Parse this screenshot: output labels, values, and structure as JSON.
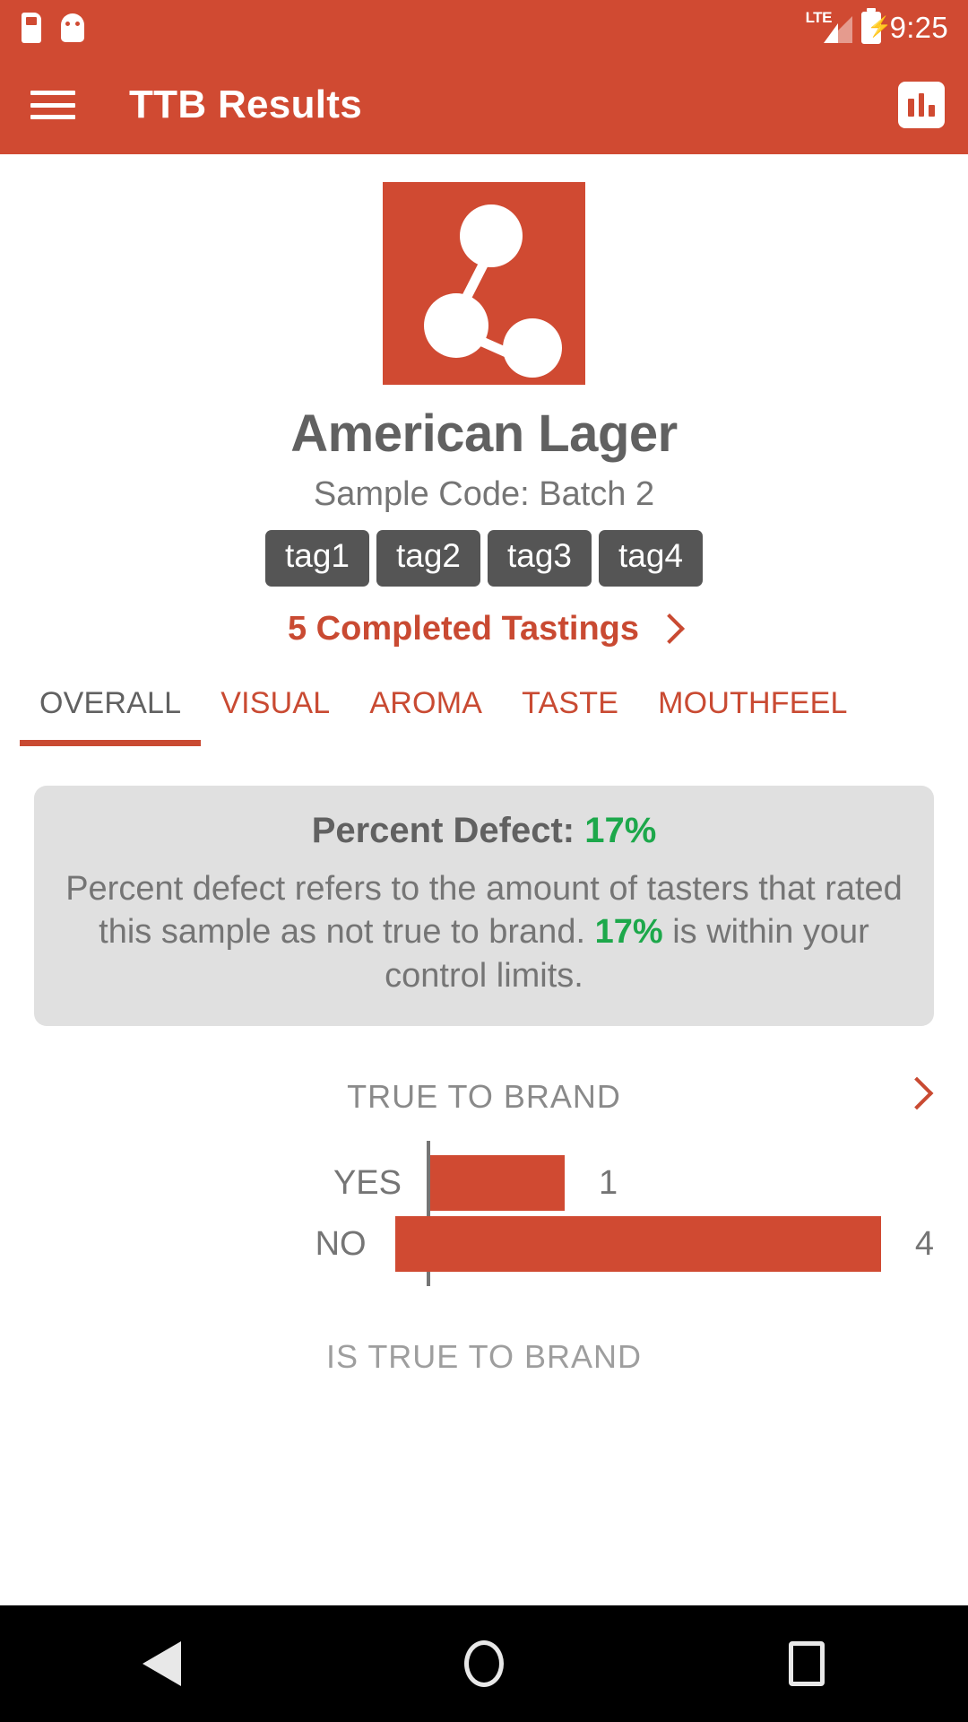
{
  "status_bar": {
    "time": "9:25",
    "network_label": "LTE",
    "icons": [
      "sd-card-icon",
      "android-robot-icon",
      "lte-signal-icon",
      "battery-charging-icon"
    ]
  },
  "app_bar": {
    "title": "TTB Results",
    "menu_icon": "hamburger-menu-icon",
    "action_icon": "bar-chart-icon"
  },
  "sample": {
    "logo_icon": "molecule-network-logo",
    "name": "American Lager",
    "sample_code": "Sample Code: Batch 2",
    "tags": [
      "tag1",
      "tag2",
      "tag3",
      "tag4"
    ],
    "tastings_link": "5 Completed Tastings",
    "tastings_chevron": "chevron-right-icon"
  },
  "tabs": [
    {
      "label": "OVERALL",
      "active": true
    },
    {
      "label": "VISUAL",
      "active": false
    },
    {
      "label": "AROMA",
      "active": false
    },
    {
      "label": "TASTE",
      "active": false
    },
    {
      "label": "MOUTHFEEL",
      "active": false
    }
  ],
  "defect_card": {
    "heading_label": "Percent Defect: ",
    "heading_value": "17%",
    "body_part1": "Percent defect refers to the amount of tasters that rated this sample as not true to brand. ",
    "body_value": "17%",
    "body_part2": " is within your control limits."
  },
  "chart_section": {
    "arrow_icon": "chevron-right-icon",
    "footer_caption": "IS TRUE TO BRAND"
  },
  "nav_bar": {
    "back_icon": "back-triangle-icon",
    "home_icon": "home-circle-icon",
    "recents_icon": "recents-square-icon"
  },
  "colors": {
    "brand_red": "#D04A32",
    "accent_red": "#C94A32",
    "tag_gray": "#555555",
    "card_gray": "#E0E0E0",
    "text_gray": "#757575",
    "success_green": "#1DA84B"
  },
  "chart_data": {
    "type": "bar",
    "orientation": "horizontal",
    "title": "TRUE TO BRAND",
    "xlabel": "",
    "ylabel": "",
    "caption": "IS TRUE TO BRAND",
    "categories": [
      "YES",
      "NO"
    ],
    "values": [
      1,
      4
    ],
    "value_labels": [
      "1",
      "4"
    ],
    "xlim": [
      0,
      5
    ],
    "grid": false,
    "legend": "none",
    "bar_color": "#D04A32"
  }
}
